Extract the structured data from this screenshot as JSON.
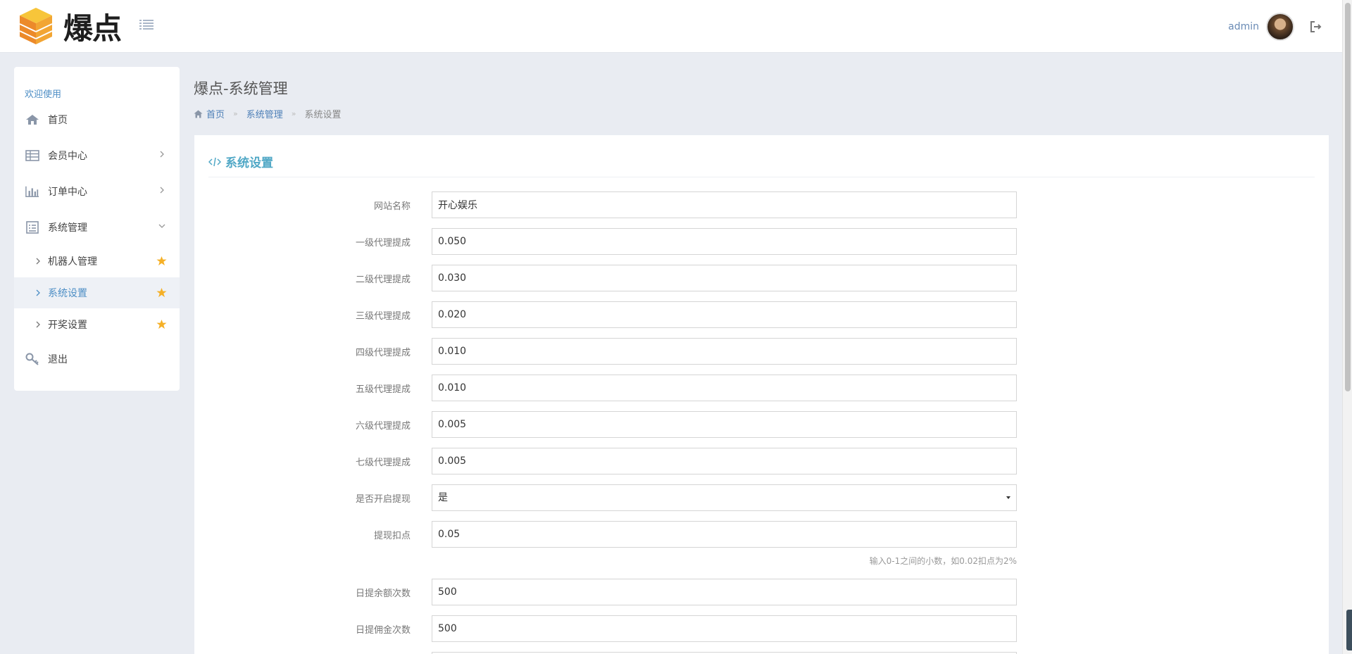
{
  "header": {
    "logo_text": "爆点",
    "admin_name": "admin"
  },
  "sidebar": {
    "welcome": "欢迎使用",
    "items": [
      {
        "label": "首页",
        "icon": "home-icon"
      },
      {
        "label": "会员中心",
        "icon": "table-icon"
      },
      {
        "label": "订单中心",
        "icon": "bar-chart-icon"
      },
      {
        "label": "系统管理",
        "icon": "list-box-icon"
      }
    ],
    "sub_items": [
      {
        "label": "机器人管理",
        "active": false
      },
      {
        "label": "系统设置",
        "active": true
      },
      {
        "label": "开奖设置",
        "active": false
      }
    ],
    "logout": "退出"
  },
  "page": {
    "title": "爆点-系统管理",
    "breadcrumb": [
      "首页",
      "系统管理",
      "系统设置"
    ]
  },
  "panel": {
    "title": "系统设置"
  },
  "form": {
    "site_name": {
      "label": "网站名称",
      "value": "开心娱乐"
    },
    "agent1": {
      "label": "一级代理提成",
      "value": "0.050"
    },
    "agent2": {
      "label": "二级代理提成",
      "value": "0.030"
    },
    "agent3": {
      "label": "三级代理提成",
      "value": "0.020"
    },
    "agent4": {
      "label": "四级代理提成",
      "value": "0.010"
    },
    "agent5": {
      "label": "五级代理提成",
      "value": "0.010"
    },
    "agent6": {
      "label": "六级代理提成",
      "value": "0.005"
    },
    "agent7": {
      "label": "七级代理提成",
      "value": "0.005"
    },
    "withdraw_enabled": {
      "label": "是否开启提现",
      "value": "是"
    },
    "withdraw_fee": {
      "label": "提现扣点",
      "value": "0.05",
      "hint": "输入0-1之间的小数，如0.02扣点为2%"
    },
    "daily_balance": {
      "label": "日提余额次数",
      "value": "500"
    },
    "daily_commission": {
      "label": "日提佣金次数",
      "value": "500"
    }
  },
  "colors": {
    "accent": "#4d8ec5",
    "panel_title": "#51a8c6",
    "star": "#f5b027",
    "background": "#e9ecf2"
  }
}
